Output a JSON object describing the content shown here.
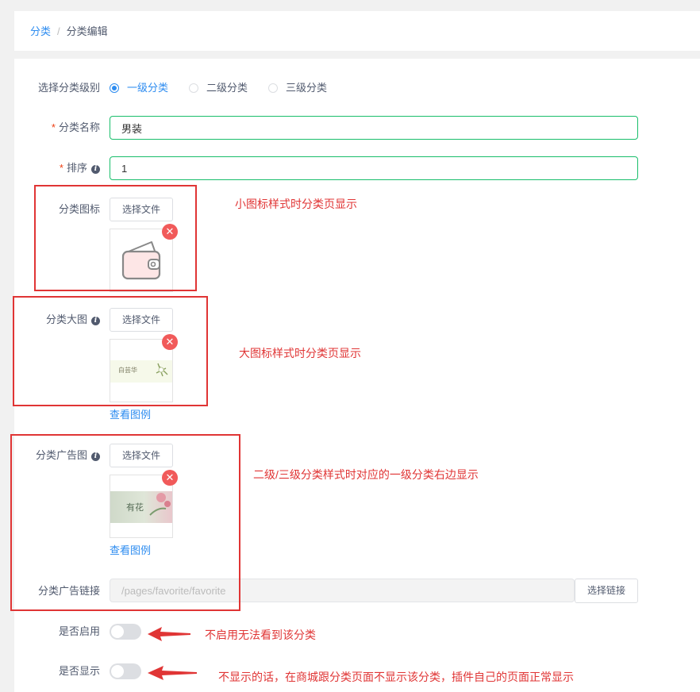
{
  "breadcrumb": {
    "parent": "分类",
    "separator": "/",
    "current": "分类编辑"
  },
  "form": {
    "level": {
      "label": "选择分类级别",
      "options": [
        {
          "label": "一级分类",
          "checked": true
        },
        {
          "label": "二级分类",
          "checked": false
        },
        {
          "label": "三级分类",
          "checked": false
        }
      ]
    },
    "name": {
      "required_mark": "*",
      "label": "分类名称",
      "value": "男装"
    },
    "sort": {
      "required_mark": "*",
      "label": "排序",
      "value": "1"
    },
    "icon": {
      "label": "分类图标",
      "button": "选择文件"
    },
    "big_image": {
      "label": "分类大图",
      "button": "选择文件",
      "example_link": "查看图例",
      "image_text": "白芸华"
    },
    "ad_image": {
      "label": "分类广告图",
      "button": "选择文件",
      "example_link": "查看图例",
      "image_text": "有花"
    },
    "ad_link": {
      "label": "分类广告链接",
      "value": "/pages/favorite/favorite",
      "button": "选择链接"
    },
    "enable": {
      "label": "是否启用",
      "on": false
    },
    "show": {
      "label": "是否显示",
      "on": false
    }
  },
  "annotations": {
    "icon_note": "小图标样式时分类页显示",
    "big_image_note": "大图标样式时分类页显示",
    "ad_image_note": "二级/三级分类样式时对应的一级分类右边显示",
    "enable_note": "不启用无法看到该分类",
    "show_note": "不显示的话，在商城跟分类页面不显示该分类，插件自己的页面正常显示"
  },
  "colors": {
    "primary": "#2d8cf0",
    "input_border_valid": "#19be6b",
    "annotation_red": "#e03535",
    "delete_button": "#f15a5a"
  },
  "icons": [
    "info-icon",
    "close-icon",
    "wallet-icon",
    "arrow-left-icon"
  ]
}
